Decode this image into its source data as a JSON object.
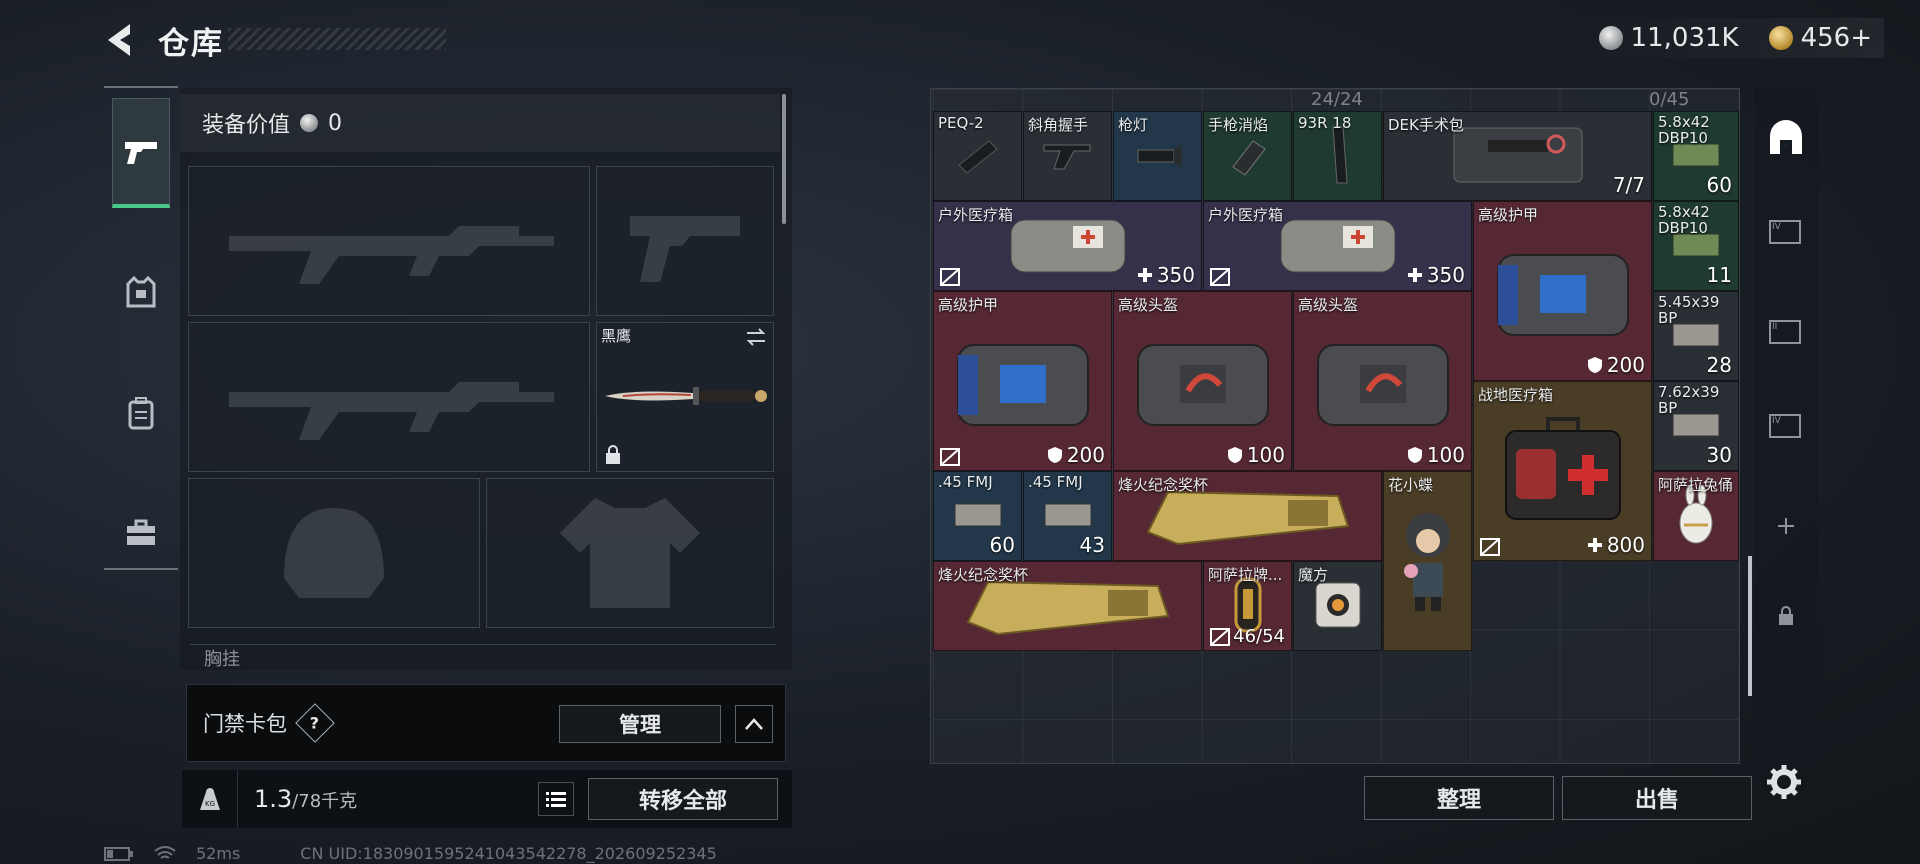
{
  "header": {
    "title": "仓库",
    "currency_silver": "11,031K",
    "currency_gold": "456+"
  },
  "equipment": {
    "value_label": "装备价值",
    "value": "0",
    "knife_name": "黑鹰",
    "chest_rig_label": "胸挂"
  },
  "keycard": {
    "label": "门禁卡包",
    "help": "?",
    "manage_label": "管理"
  },
  "weight": {
    "current": "1.3",
    "capacity": "/78千克",
    "transfer_label": "转移全部"
  },
  "status": {
    "ping": "52ms",
    "uid": "CN UID:1830901595241043542278_202609252345"
  },
  "storage": {
    "capacity_left": "24/24",
    "capacity_right": "0/45",
    "sort_label": "整理",
    "sell_label": "出售",
    "items": {
      "peq2": {
        "name": "PEQ-2"
      },
      "angled_grip": {
        "name": "斜角握手"
      },
      "flashlight": {
        "name": "枪灯"
      },
      "suppressor": {
        "name": "手枪消焰"
      },
      "mag93r": {
        "name": "93R 18"
      },
      "dek_kit": {
        "name": "DEK手术包",
        "value": "7/7"
      },
      "ammo_58_a": {
        "name": "5.8x42 DBP10",
        "value": "60"
      },
      "med_outdoor_1": {
        "name": "户外医疗箱",
        "value": "350"
      },
      "med_outdoor_2": {
        "name": "户外医疗箱",
        "value": "350"
      },
      "armor_top": {
        "name": "高级护甲",
        "value": "200"
      },
      "ammo_58_b": {
        "name": "5.8x42 DBP10",
        "value": "11"
      },
      "armor_left": {
        "name": "高级护甲",
        "value": "200"
      },
      "helmet_1": {
        "name": "高级头盔",
        "value": "100"
      },
      "helmet_2": {
        "name": "高级头盔",
        "value": "100"
      },
      "ammo_545": {
        "name": "5.45x39 BP",
        "value": "28"
      },
      "ammo_762": {
        "name": "7.62x39 BP",
        "value": "30"
      },
      "field_med": {
        "name": "战地医疗箱",
        "value": "800"
      },
      "ammo_45_a": {
        "name": ".45 FMJ",
        "value": "60"
      },
      "ammo_45_b": {
        "name": ".45 FMJ",
        "value": "43"
      },
      "trophy_1": {
        "name": "烽火纪念奖杯"
      },
      "butterfly": {
        "name": "花小蝶"
      },
      "asala_doll": {
        "name": "阿萨拉兔俑"
      },
      "trophy_2": {
        "name": "烽火纪念奖杯"
      },
      "asala_plaque": {
        "name": "阿萨拉牌...",
        "value": "46/54"
      },
      "cube": {
        "name": "魔方"
      }
    }
  },
  "colors": {
    "accent_green": "#48c98a",
    "rarity_red": "#552833",
    "rarity_gold": "#4a3d26",
    "rarity_purple": "#37304a",
    "rarity_blue": "#22384a",
    "rarity_green": "#1f3a30"
  }
}
